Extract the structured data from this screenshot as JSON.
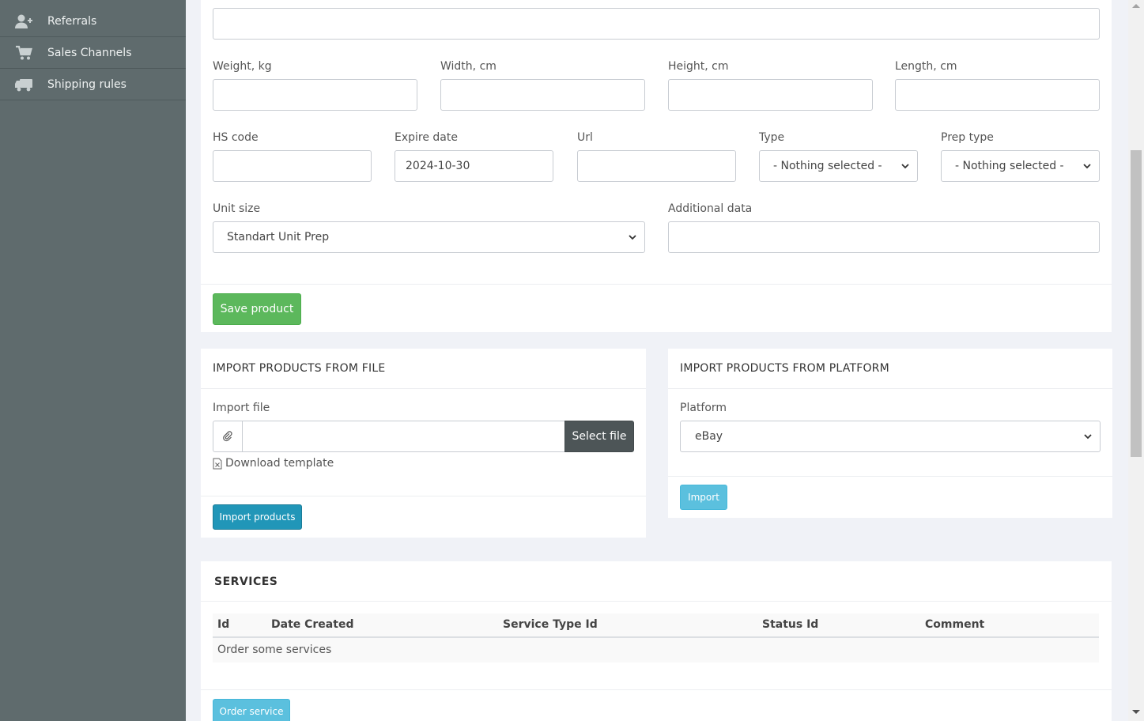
{
  "sidebar": {
    "items": [
      {
        "label": "Referrals",
        "icon": "user-plus-icon"
      },
      {
        "label": "Sales Channels",
        "icon": "cart-icon"
      },
      {
        "label": "Shipping rules",
        "icon": "truck-icon"
      }
    ]
  },
  "product_form": {
    "top_field_value": "",
    "weight_label": "Weight, kg",
    "width_label": "Width, cm",
    "height_label": "Height, cm",
    "length_label": "Length, cm",
    "hs_code_label": "HS code",
    "expire_date_label": "Expire date",
    "expire_date_value": "2024-10-30",
    "url_label": "Url",
    "type_label": "Type",
    "type_value": "- Nothing selected -",
    "prep_type_label": "Prep type",
    "prep_type_value": "- Nothing selected -",
    "unit_size_label": "Unit size",
    "unit_size_value": "Standart Unit Prep",
    "additional_data_label": "Additional data",
    "save_label": "Save product"
  },
  "import_file": {
    "title": "IMPORT PRODUCTS FROM FILE",
    "file_label": "Import file",
    "select_file_label": "Select file",
    "download_template_label": "Download template",
    "import_label": "Import products"
  },
  "import_platform": {
    "title": "IMPORT PRODUCTS FROM PLATFORM",
    "platform_label": "Platform",
    "platform_value": "eBay",
    "import_label": "Import"
  },
  "services": {
    "title": "SERVICES",
    "columns": [
      "Id",
      "Date Created",
      "Service Type Id",
      "Status Id",
      "Comment"
    ],
    "empty_text": "Order some services",
    "order_label": "Order service"
  },
  "colors": {
    "sidebar_bg": "#5f6b6d",
    "save_green": "#5cb85c",
    "import_blue": "#2196b8",
    "light_blue": "#5bc0de",
    "select_file_dark": "#4d5557"
  }
}
